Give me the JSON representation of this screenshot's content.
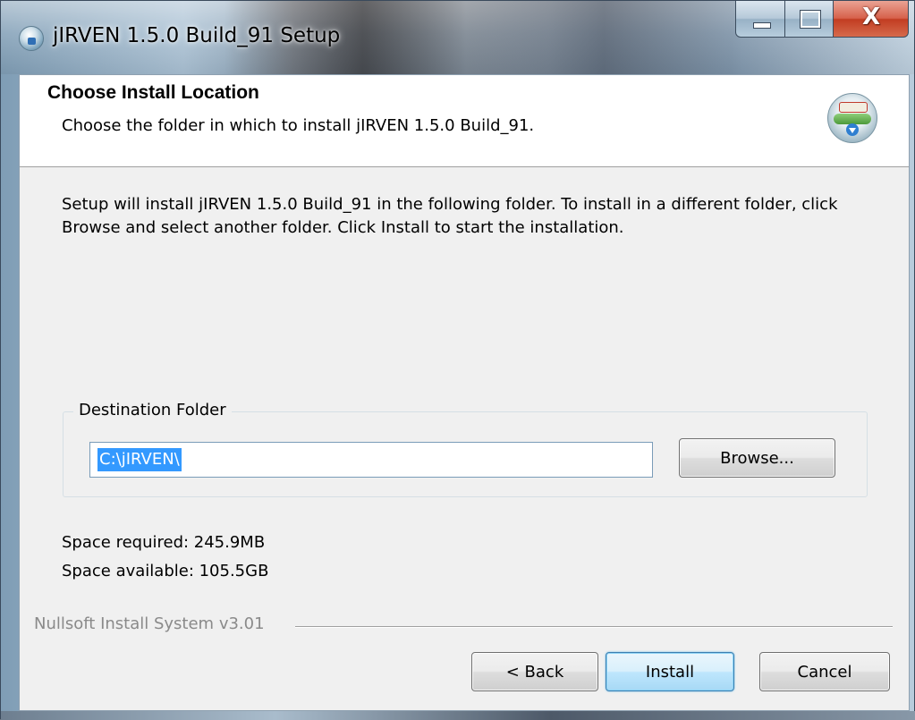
{
  "window": {
    "title": "jIRVEN 1.5.0 Build_91 Setup",
    "title_icon": "setup-globe-icon",
    "minimize_icon": "minimize-icon",
    "maximize_icon": "maximize-icon",
    "close_icon": "close-icon",
    "close_glyph": "X"
  },
  "header": {
    "title": "Choose Install Location",
    "subtitle": "Choose the folder in which to install jIRVEN 1.5.0 Build_91.",
    "icon": "installer-globe-icon"
  },
  "body": {
    "instructions": "Setup will install jIRVEN 1.5.0 Build_91 in the following folder. To install in a different folder, click Browse and select another folder. Click Install to start the installation."
  },
  "destination": {
    "group_label": "Destination Folder",
    "path": "C:\\jIRVEN\\",
    "browse_label": "Browse..."
  },
  "space": {
    "required": "Space required: 245.9MB",
    "available": "Space available: 105.5GB"
  },
  "branding": {
    "text": "Nullsoft Install System v3.01"
  },
  "buttons": {
    "back": "< Back",
    "install": "Install",
    "cancel": "Cancel"
  },
  "colors": {
    "selection": "#3399ff",
    "client_bg": "#f0f0f0",
    "close_button": "#c23d22",
    "default_button_border": "#3c7fb1"
  }
}
